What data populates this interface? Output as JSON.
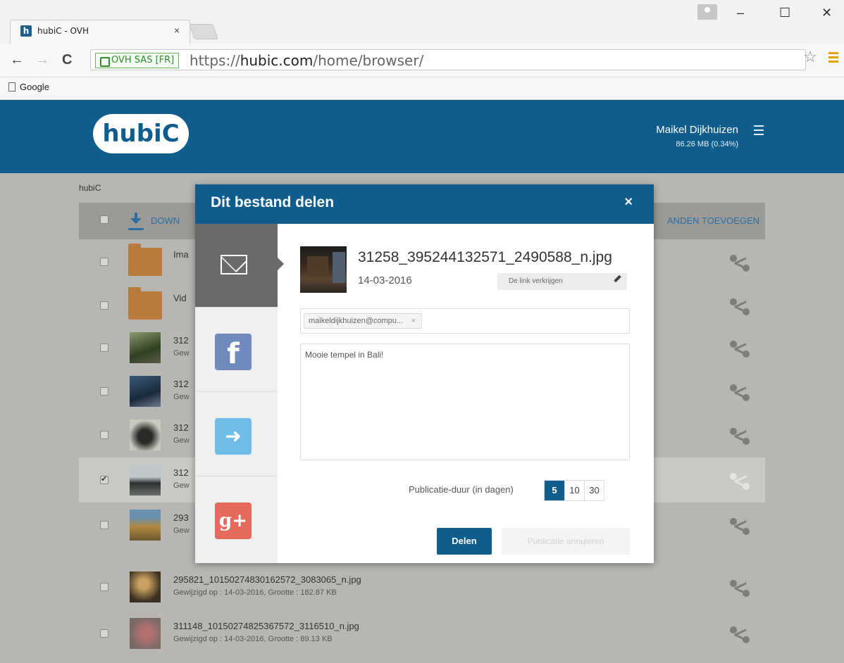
{
  "browser": {
    "tab_title": "hubiC - OVH",
    "tab_close": "×",
    "favicon": "h",
    "security_label": "OVH SAS [FR]",
    "url_prefix": "https://",
    "url_domain": "hubic.com",
    "url_path": "/home/browser/",
    "bookmark": "Google",
    "window_controls": {
      "minimize": "–",
      "maximize": "☐",
      "close": "✕"
    },
    "nav": {
      "back": "←",
      "forward": "→",
      "reload": "C"
    },
    "star": "☆"
  },
  "app": {
    "logo": "hubiC",
    "user_name": "Maikel Dijkhuizen",
    "usage": "86.26 MB (0.34%)",
    "breadcrumb": "hubiC",
    "toolbar": {
      "download": "DOWN",
      "add_files": "ANDEN TOEVOEGEN"
    }
  },
  "files": [
    {
      "name": "Ima",
      "meta": "",
      "type": "folder",
      "checked": false
    },
    {
      "name": "Vid",
      "meta": "",
      "type": "folder",
      "checked": false
    },
    {
      "name": "312",
      "meta": "Gew",
      "type": "image",
      "checked": false
    },
    {
      "name": "312",
      "meta": "Gew",
      "type": "image",
      "checked": false
    },
    {
      "name": "312",
      "meta": "Gew",
      "type": "image",
      "checked": false
    },
    {
      "name": "312",
      "meta": "Gew",
      "type": "image",
      "checked": true
    },
    {
      "name": "293",
      "meta": "Gew",
      "type": "image",
      "checked": false
    },
    {
      "name": "295821_10150274830162572_3083065_n.jpg",
      "meta": "Gewijzigd op : 14-03-2016, Grootte : 182.87 KB",
      "type": "image",
      "checked": false
    },
    {
      "name": "311148_10150274825367572_3116510_n.jpg",
      "meta": "Gewijzigd op : 14-03-2016, Grootte : 89.13 KB",
      "type": "image",
      "checked": false
    }
  ],
  "modal": {
    "title": "Dit bestand delen",
    "close": "×",
    "file_name": "31258_395244132571_2490588_n.jpg",
    "file_date": "14-03-2016",
    "get_link": "De link verkrijgen",
    "recipient": "maikeldijkhuizen@compu...",
    "recipient_remove": "×",
    "message": "Mooie tempel in Bali!",
    "duration_label": "Publicatie-duur (in dagen)",
    "durations": [
      "5",
      "10",
      "30"
    ],
    "selected_duration": "5",
    "share_button": "Delen",
    "cancel_button": "Publicatie annuleren",
    "social": {
      "facebook": "f",
      "twitter": "➜",
      "google": "g+"
    }
  }
}
